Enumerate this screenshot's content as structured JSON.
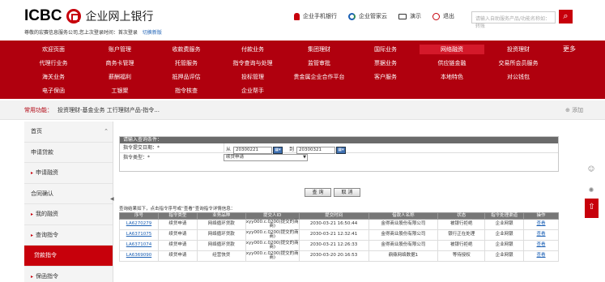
{
  "header": {
    "logo_text": "ICBC",
    "logo_cn": "企业网上银行",
    "welcome": "尊敬的宏赛信息服务公司,您上次登录时间：首次登录",
    "switch_version": "切换新版",
    "links": [
      {
        "label": "企业手机银行",
        "icon": "phone-user-icon",
        "color": "#c7000b"
      },
      {
        "label": "企业管家云",
        "icon": "cloud-icon",
        "color": "#1a5fb4"
      },
      {
        "label": "演示",
        "icon": "video-icon",
        "color": "#333333"
      },
      {
        "label": "退出",
        "icon": "power-icon",
        "color": "#c7000b"
      }
    ],
    "search_placeholder": "请输入自助服务产品/功能名称如：转账"
  },
  "nav": {
    "rows": [
      [
        "欢迎页面",
        "账户管理",
        "收款费服务",
        "付款业务",
        "集团理财",
        "国际业务",
        "网络融资",
        "投资理财"
      ],
      [
        "代理行业务",
        "商务卡管理",
        "托管服务",
        "指令查询与处理",
        "监管审批",
        "票据业务",
        "供应链金融",
        "交易所会员服务"
      ],
      [
        "海关业务",
        "薪酬福利",
        "抵押品评估",
        "投标管理",
        "贵金属企业合作平台",
        "客户服务",
        "本地特色",
        "对公钱包"
      ],
      [
        "电子保函",
        "工银聚",
        "指令核查",
        "企业帮手"
      ]
    ],
    "more": "更多",
    "active_item": "网络融资"
  },
  "common": {
    "label": "常用功能：",
    "items": "投资理财-基金业务    工行理财产品-指令...",
    "add": "⊕ 添加"
  },
  "sidebar": {
    "items": [
      {
        "label": "首页",
        "arrow": false
      },
      {
        "label": "申请贷款",
        "arrow": false
      },
      {
        "label": "申请融资",
        "arrow": true
      },
      {
        "label": "合同确认",
        "arrow": false
      },
      {
        "label": "我的融资",
        "arrow": true
      },
      {
        "label": "查询指令",
        "arrow": true
      },
      {
        "label": "贷款指令",
        "arrow": false,
        "active": true
      },
      {
        "label": "保函指令",
        "arrow": true
      }
    ]
  },
  "query": {
    "title": "请输入查询条件：",
    "date_label": "指令提交日期：*",
    "from_label": "从",
    "from_value": "20300221",
    "to_label": "到",
    "to_value": "20300321",
    "type_label": "指令类型：*",
    "type_value": "续贷申请",
    "query_btn": "查 询",
    "cancel_btn": "取 消"
  },
  "results": {
    "tip": "查询结果如下，点击指令序号或“查看”查询指令详情信息：",
    "headers": [
      "序号",
      "指令类型",
      "业务品种",
      "提交人ID",
      "提交时间",
      "借款人名称",
      "状态",
      "指令处理渠道",
      "操作"
    ],
    "rows": [
      [
        "LA6270279",
        "续贷申请",
        "网络循环贷款",
        "xyy000.c.0200(提交的商商)",
        "2030-03-21 16:50:44",
        "金得商业股份有限公司",
        "被银行拒绝",
        "企业网银",
        "查看"
      ],
      [
        "LA6371075",
        "续贷申请",
        "网络循环贷款",
        "xyy000.c.0200(提交的商商)",
        "2030-03-21 12:32:41",
        "金得商业股份有限公司",
        "银行正在处理",
        "企业网银",
        "查看"
      ],
      [
        "LA6371074",
        "续贷申请",
        "网络循环贷款",
        "xyy000.c.0200(提交的商商)",
        "2030-03-21 12:26:33",
        "金得商业股份有限公司",
        "被银行拒绝",
        "企业网银",
        "查看"
      ],
      [
        "LA6369090",
        "续贷申请",
        "经营快贷",
        "xyy000.c.0200(提交的商商)",
        "2030-03-20 20:16:53",
        "鼎鼎网络数据1",
        "等待授权",
        "企业网银",
        "查看"
      ]
    ]
  },
  "colors": {
    "brand": "#c7000b",
    "nav_bg": "#b0000e",
    "link": "#1a5fb4"
  }
}
